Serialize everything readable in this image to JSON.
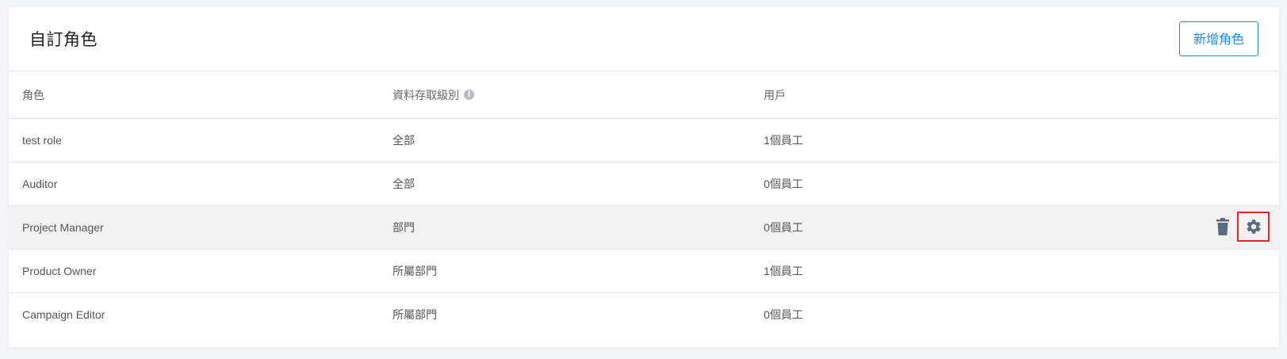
{
  "header": {
    "title": "自訂角色",
    "add_button_label": "新增角色"
  },
  "table": {
    "columns": {
      "role": "角色",
      "access_level": "資料存取級別",
      "users": "用戶"
    },
    "rows": [
      {
        "role": "test role",
        "access_level": "全部",
        "users": "1個員工"
      },
      {
        "role": "Auditor",
        "access_level": "全部",
        "users": "0個員工"
      },
      {
        "role": "Project Manager",
        "access_level": "部門",
        "users": "0個員工"
      },
      {
        "role": "Product Owner",
        "access_level": "所屬部門",
        "users": "1個員工"
      },
      {
        "role": "Campaign Editor",
        "access_level": "所屬部門",
        "users": "0個員工"
      }
    ]
  },
  "icons": {
    "info": "info-icon",
    "delete": "trash-icon",
    "settings": "gear-icon"
  },
  "colors": {
    "accent": "#1e88e5",
    "icon": "#5b6b80",
    "highlight_border": "#e0252b"
  }
}
